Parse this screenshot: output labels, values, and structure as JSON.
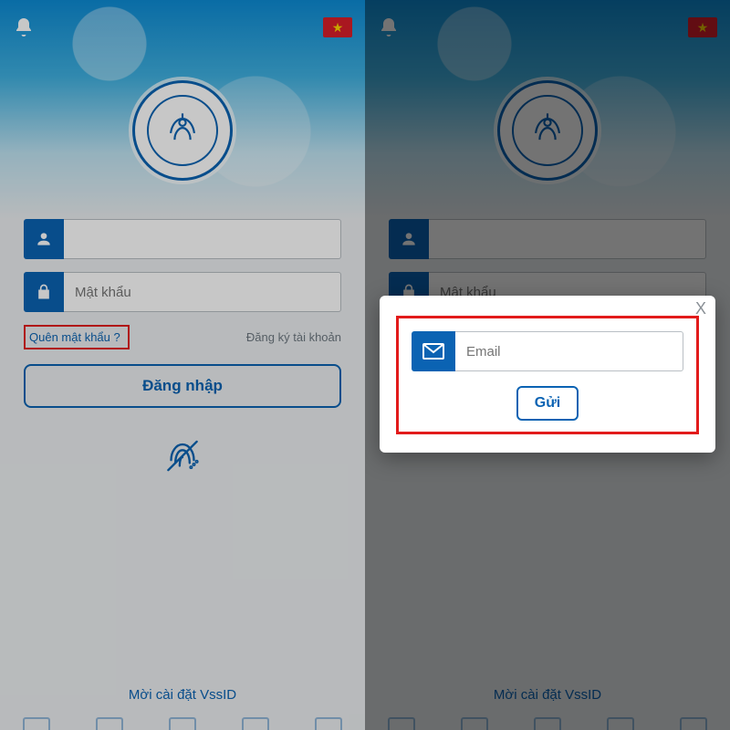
{
  "logo_alt": "BẢO HIỂM XÃ HỘI VIỆT NAM",
  "left": {
    "username_value": "",
    "password_placeholder": "Mật khẩu",
    "forgot_label": "Quên mật khẩu ?",
    "register_label": "Đăng ký tài khoản",
    "login_label": "Đăng nhập",
    "footer_label": "Mời cài đặt VssID"
  },
  "right": {
    "password_placeholder": "Mật khẩu",
    "footer_label": "Mời cài đặt VssID",
    "modal": {
      "email_placeholder": "Email",
      "send_label": "Gửi",
      "close_label": "X"
    }
  }
}
